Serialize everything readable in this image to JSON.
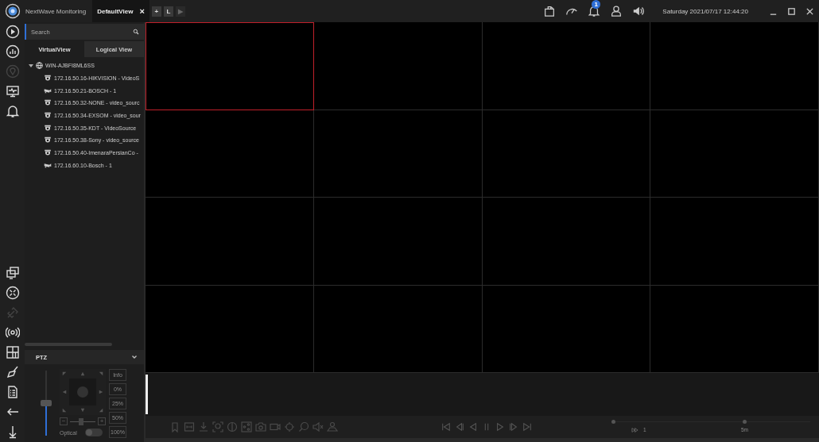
{
  "app": {
    "title": "NextWave Monitoring"
  },
  "tabs": [
    {
      "label": "DefaultView",
      "selected": true,
      "close": "×"
    }
  ],
  "tab_actions": [
    "+",
    "L",
    "▶"
  ],
  "header": {
    "notifications": "1",
    "datetime": "Saturday 2021/07/17 12:44:20"
  },
  "rail_top": [
    {
      "kind": "play",
      "disabled": false
    },
    {
      "kind": "chart",
      "disabled": false
    },
    {
      "kind": "pin",
      "disabled": true
    },
    {
      "kind": "monitor",
      "disabled": false
    },
    {
      "kind": "bell",
      "disabled": false
    }
  ],
  "rail_bottom": [
    {
      "kind": "screens",
      "disabled": false
    },
    {
      "kind": "expand",
      "disabled": false
    },
    {
      "kind": "link",
      "disabled": true
    },
    {
      "kind": "broadcast",
      "disabled": false
    },
    {
      "kind": "layout",
      "disabled": false
    },
    {
      "kind": "brush",
      "disabled": false
    },
    {
      "kind": "doc",
      "disabled": false
    },
    {
      "kind": "left",
      "disabled": false
    },
    {
      "kind": "down",
      "disabled": false
    }
  ],
  "search": {
    "placeholder": "Search"
  },
  "view_tabs": [
    {
      "label": "VirtualView",
      "selected": true
    },
    {
      "label": "Logical View",
      "selected": false
    }
  ],
  "tree": {
    "label": "WIN-AJBFI8ML6SS",
    "expanded": true,
    "children": [
      {
        "label": "172.16.50.16-HIKVISION - VideoS",
        "kind": "dome"
      },
      {
        "label": "172.16.50.21-BOSCH - 1",
        "kind": "bullet"
      },
      {
        "label": "172.16.50.32-NONE - video_sourc",
        "kind": "dome"
      },
      {
        "label": "172.16.50.34-EXSOM - video_sour",
        "kind": "dome"
      },
      {
        "label": "172.16.50.35-KDT - VideoSource",
        "kind": "dome"
      },
      {
        "label": "172.16.50.38-Sony - video_source",
        "kind": "dome"
      },
      {
        "label": "172.16.50.40-ImenaraPersianCo -",
        "kind": "dome"
      },
      {
        "label": "172.16.60.10-Bosch - 1",
        "kind": "bullet"
      }
    ]
  },
  "ptz": {
    "title": "PTZ",
    "expanded": true,
    "speed": {
      "level": 0.5
    },
    "zoom": {
      "level": 0.45,
      "minus": "−",
      "plus": "+"
    },
    "presets": [
      "Info",
      "0%",
      "25%",
      "50%",
      "100%"
    ],
    "optical": {
      "label": "Optical",
      "on": false
    }
  },
  "grid": {
    "cells": [
      {
        "selected": true
      },
      {
        "selected": false
      },
      {
        "selected": false
      },
      {
        "selected": false
      },
      {
        "selected": false
      },
      {
        "selected": false
      },
      {
        "selected": false
      },
      {
        "selected": false
      },
      {
        "selected": false
      },
      {
        "selected": false
      },
      {
        "selected": false
      },
      {
        "selected": false
      },
      {
        "selected": false
      },
      {
        "selected": false
      },
      {
        "selected": false
      },
      {
        "selected": false
      }
    ]
  },
  "playback": {
    "speed": "1",
    "range": "5m"
  }
}
